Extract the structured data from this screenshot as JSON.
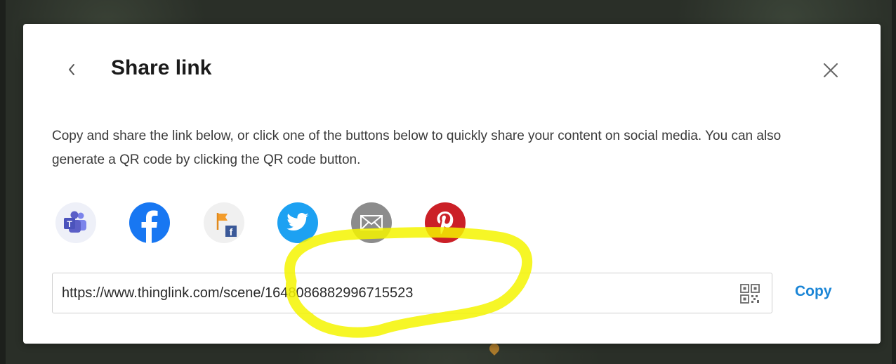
{
  "dialog": {
    "title": "Share link",
    "description": "Copy and share the link below, or click one of the buttons below to quickly share your content on social media. You can also generate a QR code by clicking the QR code button.",
    "back_icon": "chevron-left-icon",
    "close_icon": "close-icon"
  },
  "share_buttons": [
    {
      "name": "Microsoft Teams",
      "icon": "teams-icon",
      "color": "#5b5fc7"
    },
    {
      "name": "Facebook",
      "icon": "facebook-icon",
      "color": "#1877f2"
    },
    {
      "name": "Workplace from Facebook",
      "icon": "workplace-flag-icon",
      "color": "#f39c2b"
    },
    {
      "name": "Twitter",
      "icon": "twitter-icon",
      "color": "#1da1f2"
    },
    {
      "name": "Email",
      "icon": "email-icon",
      "color": "#8c8c8c"
    },
    {
      "name": "Pinterest",
      "icon": "pinterest-icon",
      "color": "#cb2027"
    }
  ],
  "link": {
    "url": "https://www.thinglink.com/scene/1648086882996715523",
    "qr_icon": "qr-code-icon",
    "copy_label": "Copy"
  },
  "colors": {
    "accent": "#1a85d6",
    "highlight": "#f5f500"
  }
}
